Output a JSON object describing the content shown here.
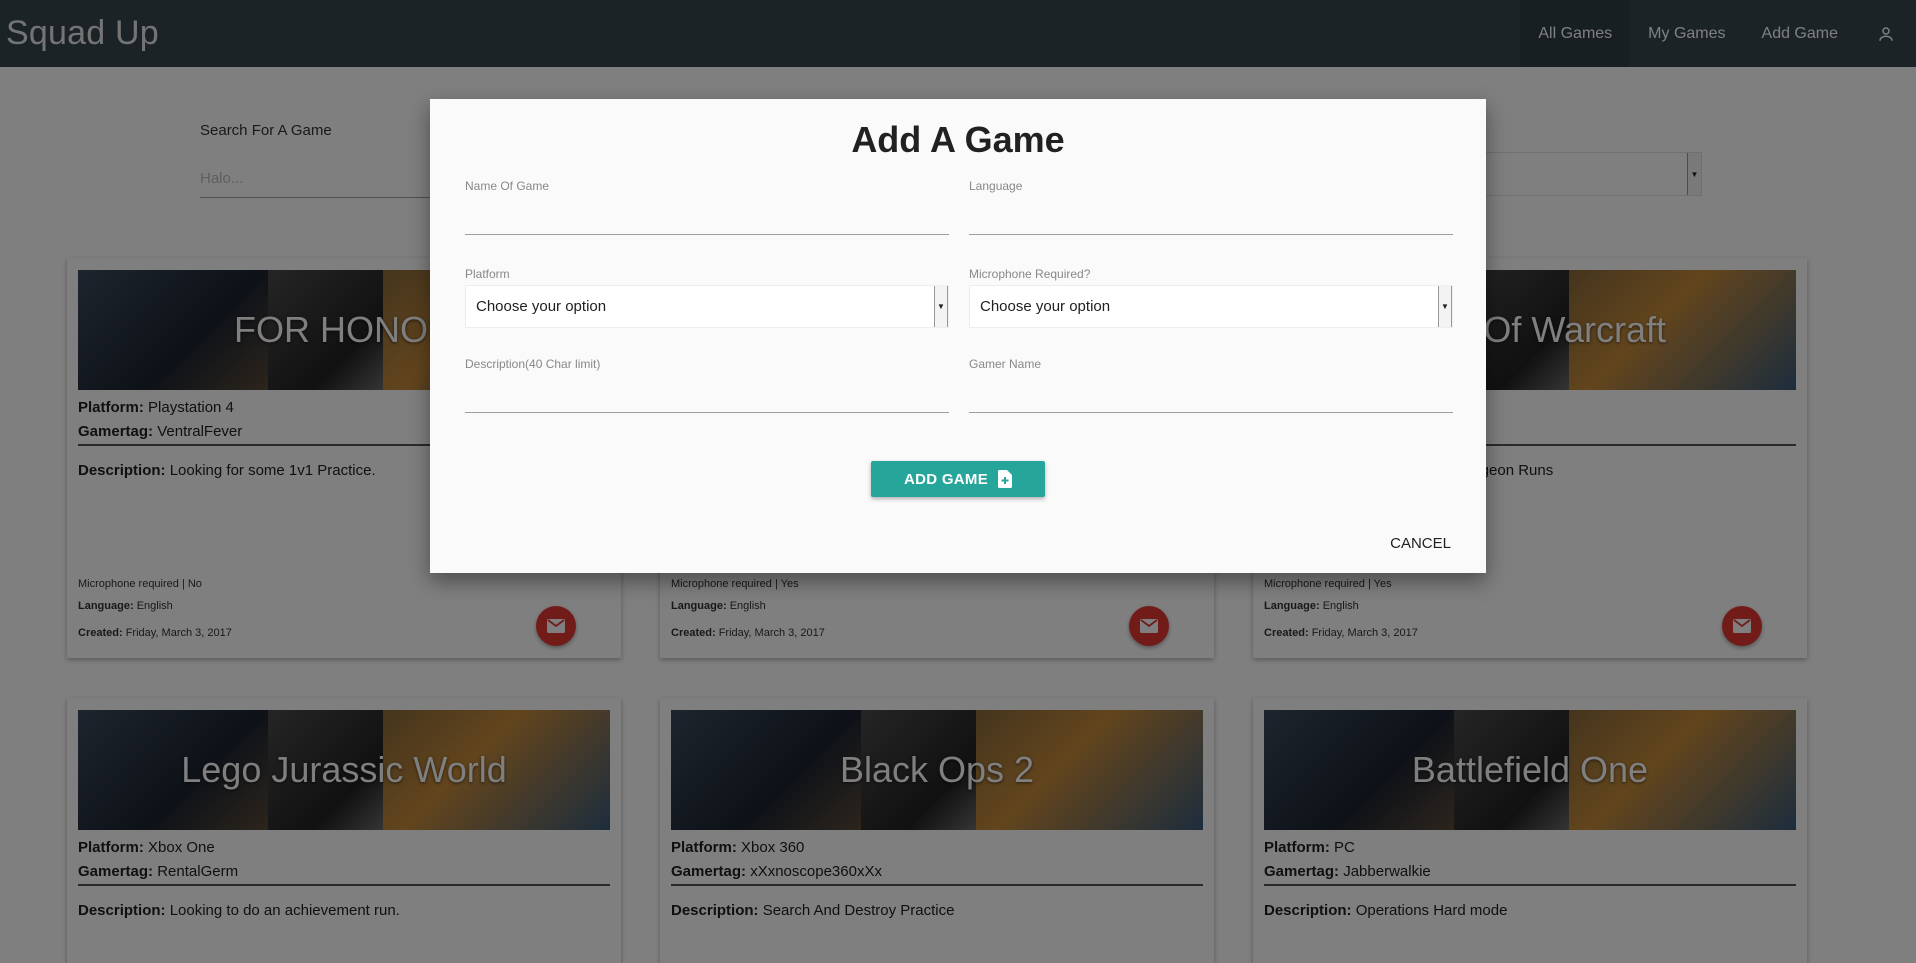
{
  "navbar": {
    "brand": "Squad Up",
    "links": [
      "All Games",
      "My Games",
      "Add Game"
    ]
  },
  "search": {
    "label": "Search For A Game",
    "placeholder": "Halo..."
  },
  "cards": [
    {
      "title": "FOR HONOR",
      "platform_label": "Platform:",
      "platform": "Playstation 4",
      "gamertag_label": "Gamertag:",
      "gamertag": "VentralFever",
      "description_label": "Description:",
      "description": "Looking for some 1v1 Practice.",
      "mic": "Microphone required | No",
      "language_label": "Language:",
      "language": "English",
      "created_label": "Created:",
      "created": "Friday, March 3, 2017"
    },
    {
      "title": "",
      "mic": "Microphone required | Yes",
      "language_label": "Language:",
      "language": "English",
      "created_label": "Created:",
      "created": "Friday, March 3, 2017"
    },
    {
      "title": "Of Warcraft",
      "description": "ungeon Runs",
      "mic": "Microphone required | Yes",
      "language_label": "Language:",
      "language": "English",
      "created_label": "Created:",
      "created": "Friday, March 3, 2017"
    },
    {
      "title": "Lego Jurassic World",
      "platform_label": "Platform:",
      "platform": "Xbox One",
      "gamertag_label": "Gamertag:",
      "gamertag": "RentalGerm",
      "description_label": "Description:",
      "description": "Looking to do an achievement run."
    },
    {
      "title": "Black Ops 2",
      "platform_label": "Platform:",
      "platform": "Xbox 360",
      "gamertag_label": "Gamertag:",
      "gamertag": "xXxnoscope360xXx",
      "description_label": "Description:",
      "description": "Search And Destroy Practice"
    },
    {
      "title": "Battlefield One",
      "platform_label": "Platform:",
      "platform": "PC",
      "gamertag_label": "Gamertag:",
      "gamertag": "Jabberwalkie",
      "description_label": "Description:",
      "description": "Operations Hard mode"
    }
  ],
  "modal": {
    "title": "Add A Game",
    "fields": {
      "name_label": "Name Of Game",
      "language_label": "Language",
      "platform_label": "Platform",
      "platform_value": "Choose your option",
      "mic_label": "Microphone Required?",
      "mic_value": "Choose your option",
      "description_label": "Description(40 Char limit)",
      "gamer_name_label": "Gamer Name"
    },
    "add_button": "ADD GAME",
    "cancel_button": "CANCEL"
  },
  "colors": {
    "navbar": "#37474f",
    "accent": "#26a69a",
    "mail_button": "#e53935"
  },
  "icons": [
    "user-icon",
    "dropdown-caret-icon",
    "mail-icon",
    "file-add-icon"
  ]
}
